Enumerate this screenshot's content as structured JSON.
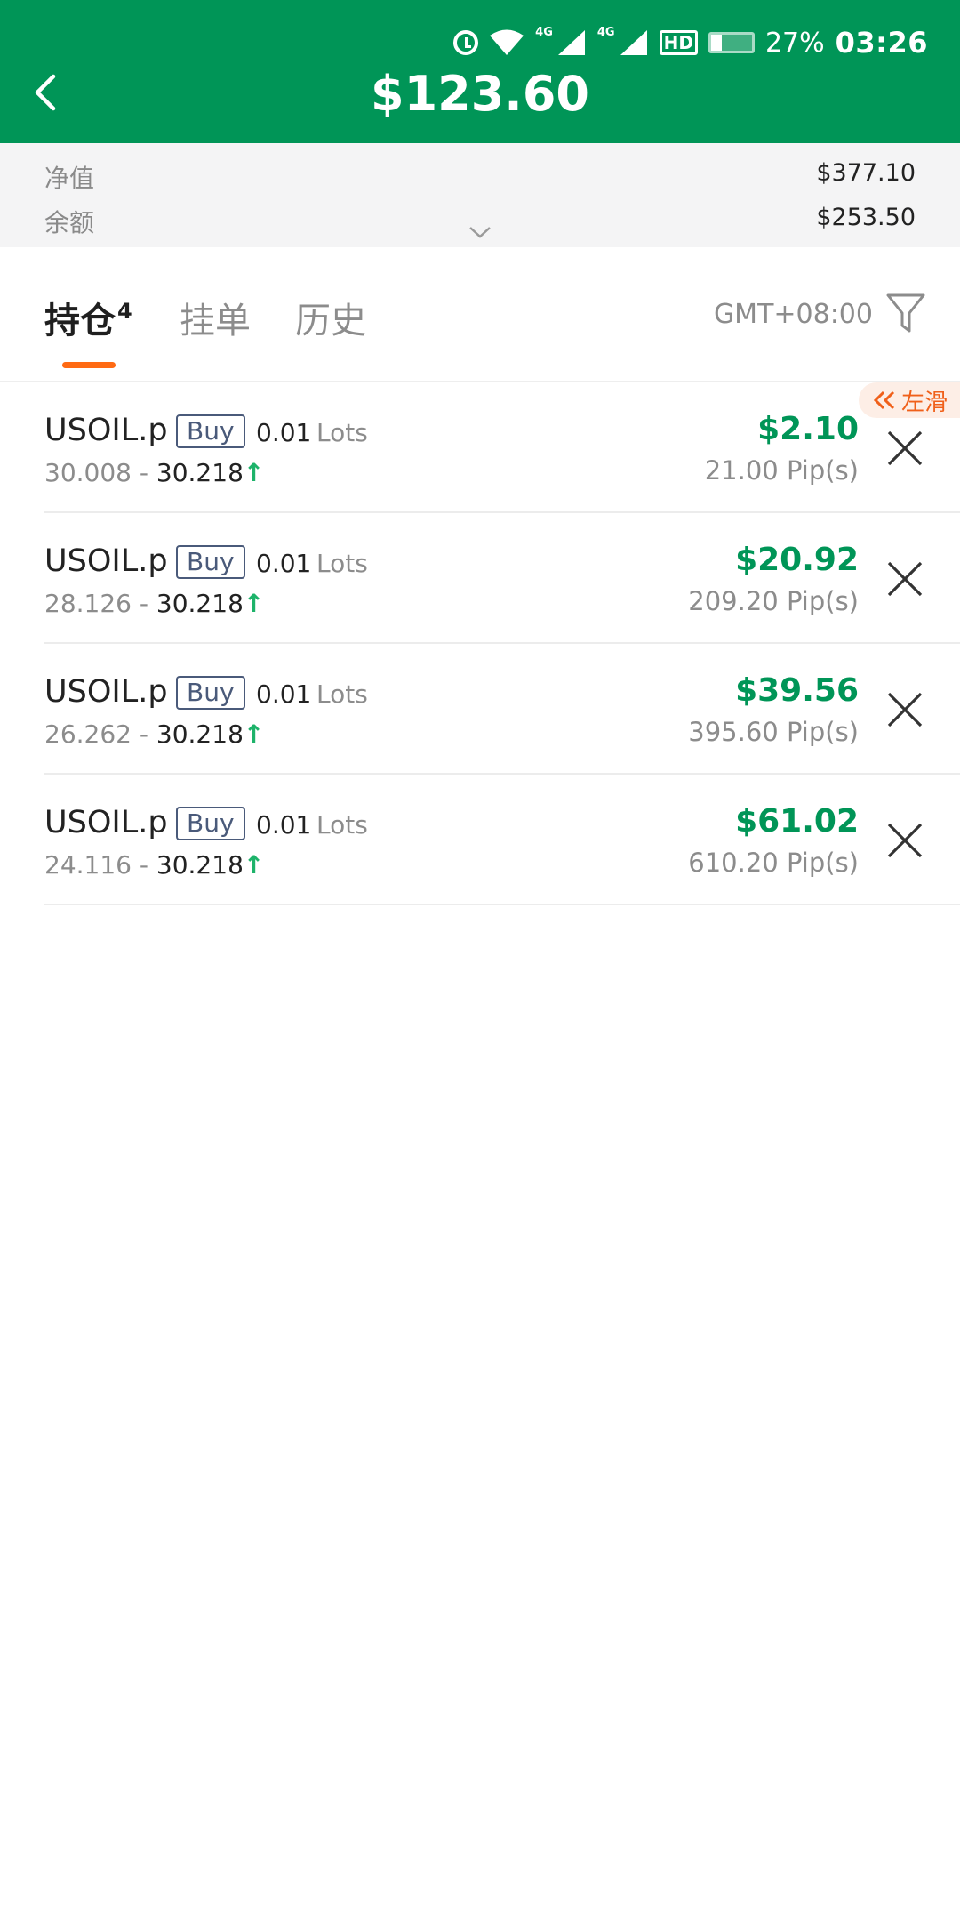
{
  "status_bar": {
    "network_1": "4G",
    "network_2": "4G",
    "hd_label": "HD",
    "battery_percent": "27%",
    "battery_level": 0.27,
    "time": "03:26"
  },
  "header": {
    "title": "$123.60"
  },
  "account_summary": {
    "equity_label": "净值",
    "equity_value": "$377.10",
    "balance_label": "余额",
    "balance_value": "$253.50"
  },
  "tabs": {
    "positions_label": "持仓",
    "positions_count": "4",
    "orders_label": "挂单",
    "history_label": "历史",
    "timezone": "GMT+08:00"
  },
  "swipe_hint": "左滑",
  "positions": [
    {
      "symbol": "USOIL.p",
      "side": "Buy",
      "lots": "0.01",
      "lots_unit": "Lots",
      "open_price": "30.008",
      "separator": "-",
      "current_price": "30.218",
      "profit": "$2.10",
      "pips": "21.00 Pip(s)"
    },
    {
      "symbol": "USOIL.p",
      "side": "Buy",
      "lots": "0.01",
      "lots_unit": "Lots",
      "open_price": "28.126",
      "separator": "-",
      "current_price": "30.218",
      "profit": "$20.92",
      "pips": "209.20 Pip(s)"
    },
    {
      "symbol": "USOIL.p",
      "side": "Buy",
      "lots": "0.01",
      "lots_unit": "Lots",
      "open_price": "26.262",
      "separator": "-",
      "current_price": "30.218",
      "profit": "$39.56",
      "pips": "395.60 Pip(s)"
    },
    {
      "symbol": "USOIL.p",
      "side": "Buy",
      "lots": "0.01",
      "lots_unit": "Lots",
      "open_price": "24.116",
      "separator": "-",
      "current_price": "30.218",
      "profit": "$61.02",
      "pips": "610.20 Pip(s)"
    }
  ],
  "colors": {
    "brand_green": "#009557",
    "accent_orange": "#ff6a13",
    "profit_green": "#009557"
  }
}
